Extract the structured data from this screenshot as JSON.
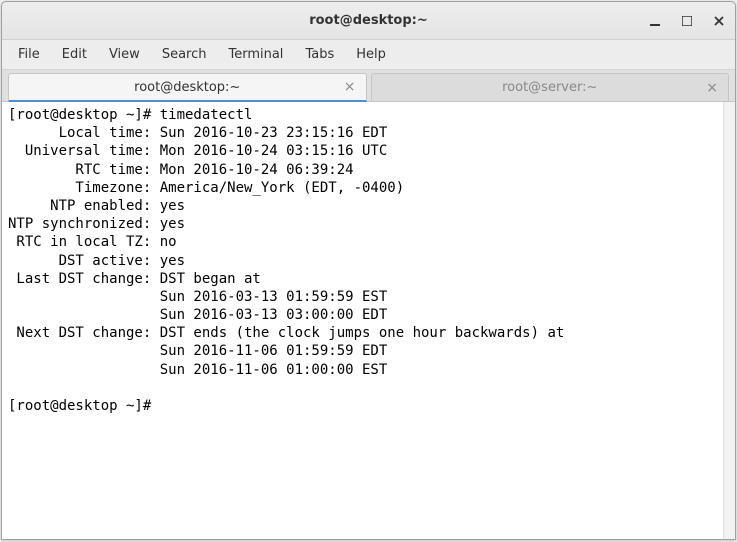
{
  "window": {
    "title": "root@desktop:~"
  },
  "menubar": {
    "file": "File",
    "edit": "Edit",
    "view": "View",
    "search": "Search",
    "terminal": "Terminal",
    "tabs": "Tabs",
    "help": "Help"
  },
  "tabs": [
    {
      "label": "root@desktop:~",
      "active": true
    },
    {
      "label": "root@server:~",
      "active": false
    }
  ],
  "terminal": {
    "line1": "[root@desktop ~]# timedatectl",
    "line2": "      Local time: Sun 2016-10-23 23:15:16 EDT",
    "line3": "  Universal time: Mon 2016-10-24 03:15:16 UTC",
    "line4": "        RTC time: Mon 2016-10-24 06:39:24",
    "line5": "        Timezone: America/New_York (EDT, -0400)",
    "line6": "     NTP enabled: yes",
    "line7": "NTP synchronized: yes",
    "line8": " RTC in local TZ: no",
    "line9": "      DST active: yes",
    "line10": " Last DST change: DST began at",
    "line11": "                  Sun 2016-03-13 01:59:59 EST",
    "line12": "                  Sun 2016-03-13 03:00:00 EDT",
    "line13": " Next DST change: DST ends (the clock jumps one hour backwards) at",
    "line14": "                  Sun 2016-11-06 01:59:59 EDT",
    "line15": "                  Sun 2016-11-06 01:00:00 EST",
    "line16": "",
    "line17": "[root@desktop ~]# "
  }
}
